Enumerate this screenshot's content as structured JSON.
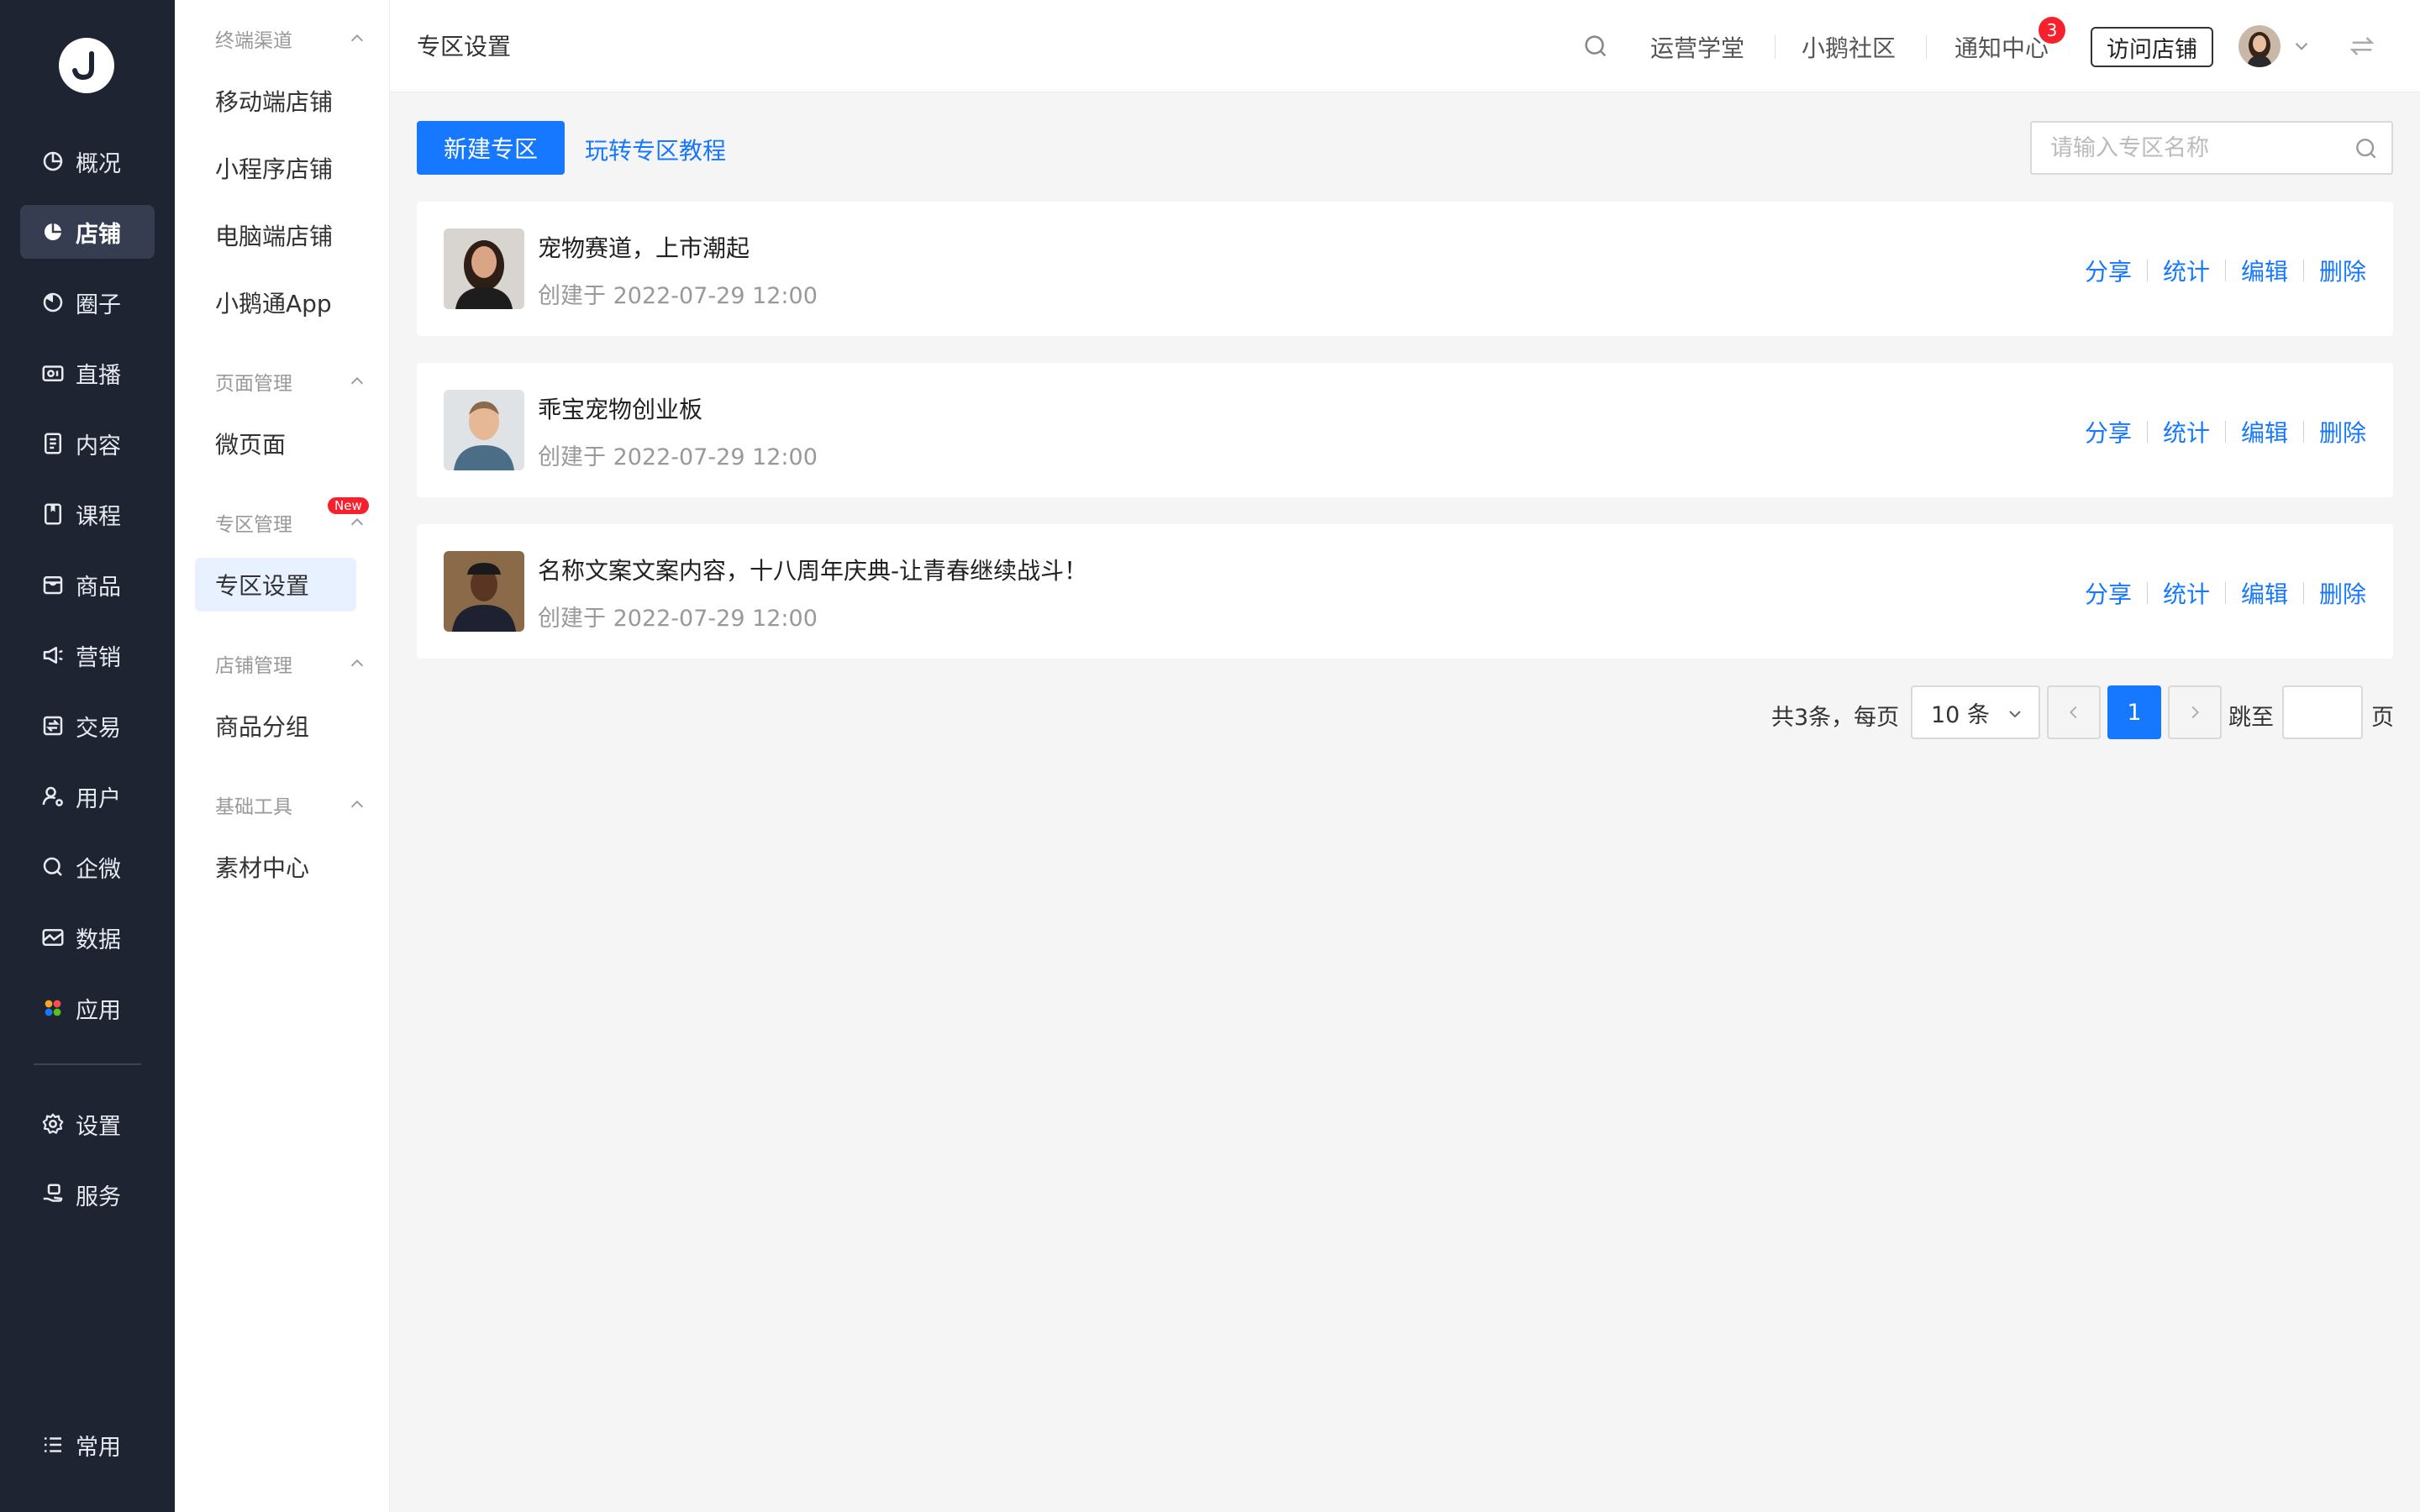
{
  "rail": {
    "items": [
      {
        "label": "概况",
        "icon": "pie-chart-icon"
      },
      {
        "label": "店铺",
        "icon": "pie-chart-filled-icon",
        "active": true
      },
      {
        "label": "圈子",
        "icon": "circle-chart-icon"
      },
      {
        "label": "直播",
        "icon": "live-camera-icon"
      },
      {
        "label": "内容",
        "icon": "document-icon"
      },
      {
        "label": "课程",
        "icon": "book-icon"
      },
      {
        "label": "商品",
        "icon": "box-icon"
      },
      {
        "label": "营销",
        "icon": "megaphone-icon"
      },
      {
        "label": "交易",
        "icon": "exchange-icon"
      },
      {
        "label": "用户",
        "icon": "user-gear-icon"
      },
      {
        "label": "企微",
        "icon": "chat-search-icon"
      },
      {
        "label": "数据",
        "icon": "image-chart-icon"
      },
      {
        "label": "应用",
        "icon": "apps-grid-icon"
      }
    ],
    "settings_label": "设置",
    "service_label": "服务",
    "common_label": "常用"
  },
  "subnav": {
    "groups": [
      {
        "title": "终端渠道",
        "items": [
          "移动端店铺",
          "小程序店铺",
          "电脑端店铺",
          "小鹅通App"
        ]
      },
      {
        "title": "页面管理",
        "items": [
          "微页面"
        ]
      },
      {
        "title": "专区管理",
        "badge": "New",
        "items": [
          "专区设置"
        ]
      },
      {
        "title": "店铺管理",
        "items": [
          "商品分组"
        ]
      },
      {
        "title": "基础工具",
        "items": [
          "素材中心"
        ]
      }
    ],
    "active_item": "专区设置"
  },
  "header": {
    "title": "专区设置",
    "links": [
      "运营学堂",
      "小鹅社区",
      "通知中心"
    ],
    "notification_count": "3",
    "visit_store_label": "访问店铺"
  },
  "toolbar": {
    "new_button_label": "新建专区",
    "tutorial_link_label": "玩转专区教程",
    "search_placeholder": "请输入专区名称",
    "search_value": ""
  },
  "zones": [
    {
      "name": "宠物赛道，上市潮起",
      "created": "创建于 2022-07-29 12:00"
    },
    {
      "name": "乖宝宠物创业板",
      "created": "创建于 2022-07-29 12:00"
    },
    {
      "name": "名称文案文案内容，十八周年庆典-让青春继续战斗！",
      "created": "创建于 2022-07-29 12:00"
    }
  ],
  "zone_actions": [
    "分享",
    "统计",
    "编辑",
    "删除"
  ],
  "pagination": {
    "total_text": "共3条，每页",
    "page_size": "10 条",
    "current_page": "1",
    "jump_label": "跳至",
    "page_label": "页"
  },
  "colors": {
    "primary": "#1677ff",
    "rail_bg": "#1f2433",
    "badge": "#f5222d"
  }
}
